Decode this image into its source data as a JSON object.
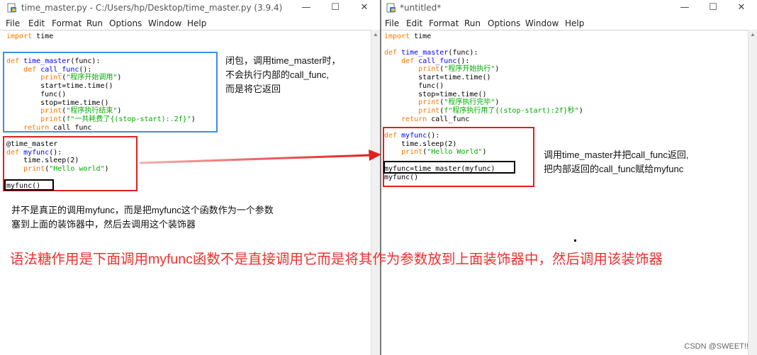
{
  "left_window": {
    "title": "time_master.py - C:/Users/hp/Desktop/time_master.py (3.9.4)",
    "controls": {
      "minimize": "—",
      "maximize": "☐",
      "close": "✕"
    },
    "menu": [
      "File",
      "Edit",
      "Format",
      "Run",
      "Options",
      "Window",
      "Help"
    ]
  },
  "right_window": {
    "title": "*untitled*",
    "controls": {
      "minimize": "—",
      "maximize": "☐",
      "close": "✕"
    },
    "menu": [
      "File",
      "Edit",
      "Format",
      "Run",
      "Options",
      "Window",
      "Help"
    ]
  },
  "annotations": {
    "closure_note": [
      "闭包，调用time_master时，",
      "不会执行内部的call_func,",
      "而是将它返回"
    ],
    "myfunc_note": [
      "并不是真正的调用myfunc，而是把myfunc这个函数作为一个参数",
      "塞到上面的装饰器中，然后去调用这个装饰器"
    ],
    "right_note": [
      "调用time_master并把call_func返回,",
      "把内部返回的call_func赋给myfunc"
    ],
    "big_note": "语法糖作用是下面调用myfunc函数不是直接调用它而是将其作为参数放到上面装饰器中，然后调用该装饰器"
  },
  "watermark": "CSDN @SWEET!!",
  "colors": {
    "keyword": "#ff7700",
    "function_name": "#0000ff",
    "string": "#00aa00",
    "annotation_red": "#ef2f2f",
    "box_blue": "#3c8ee6",
    "box_red": "#e02020"
  }
}
